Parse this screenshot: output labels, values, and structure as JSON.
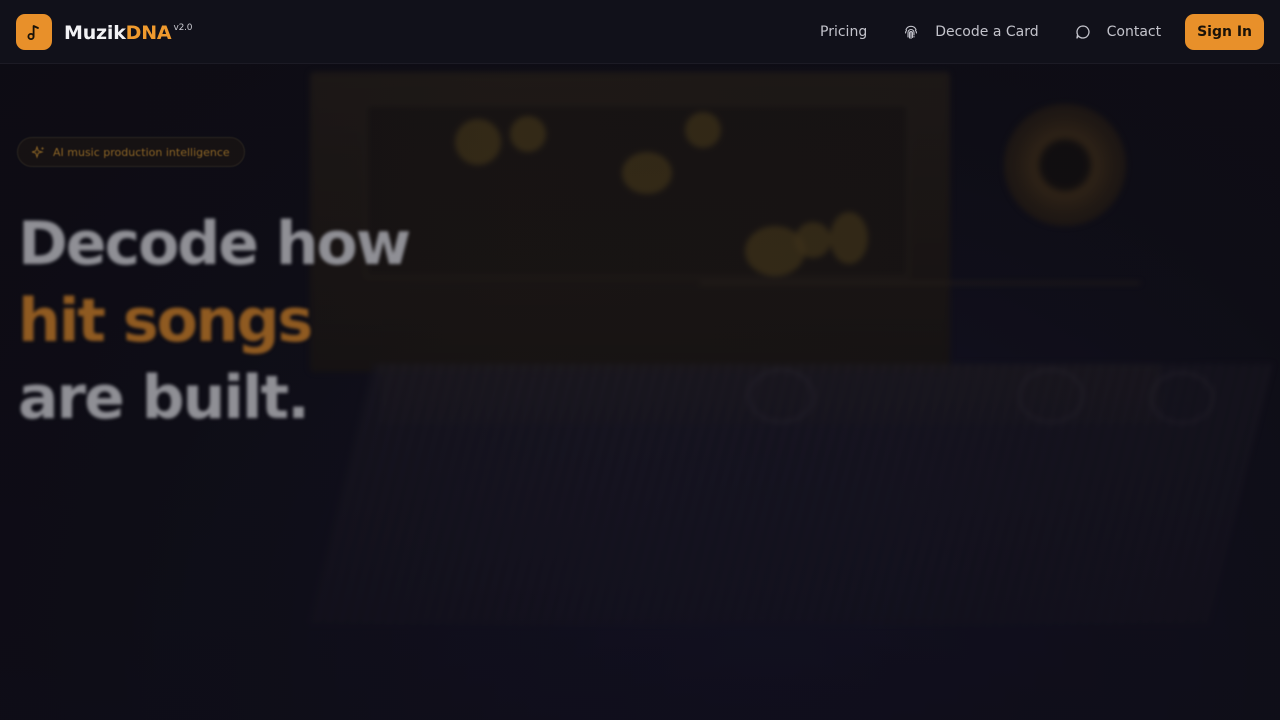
{
  "brand": {
    "name_main": "Muzik",
    "name_accent": "DNA",
    "version": "v2.0",
    "logo_icon": "music-note-icon"
  },
  "nav": {
    "pricing": "Pricing",
    "decode": "Decode a Card",
    "decode_icon": "fingerprint-icon",
    "contact": "Contact",
    "contact_icon": "chat-bubble-icon",
    "signin": "Sign In"
  },
  "hero": {
    "badge": "AI music production intelligence",
    "badge_icon": "sparkle-icon",
    "headline_line1": "Decode how",
    "headline_line2": "hit songs",
    "headline_line3": "are built."
  },
  "colors": {
    "accent": "#e8902a",
    "background": "#0e0d16",
    "nav_background": "#11111a"
  }
}
